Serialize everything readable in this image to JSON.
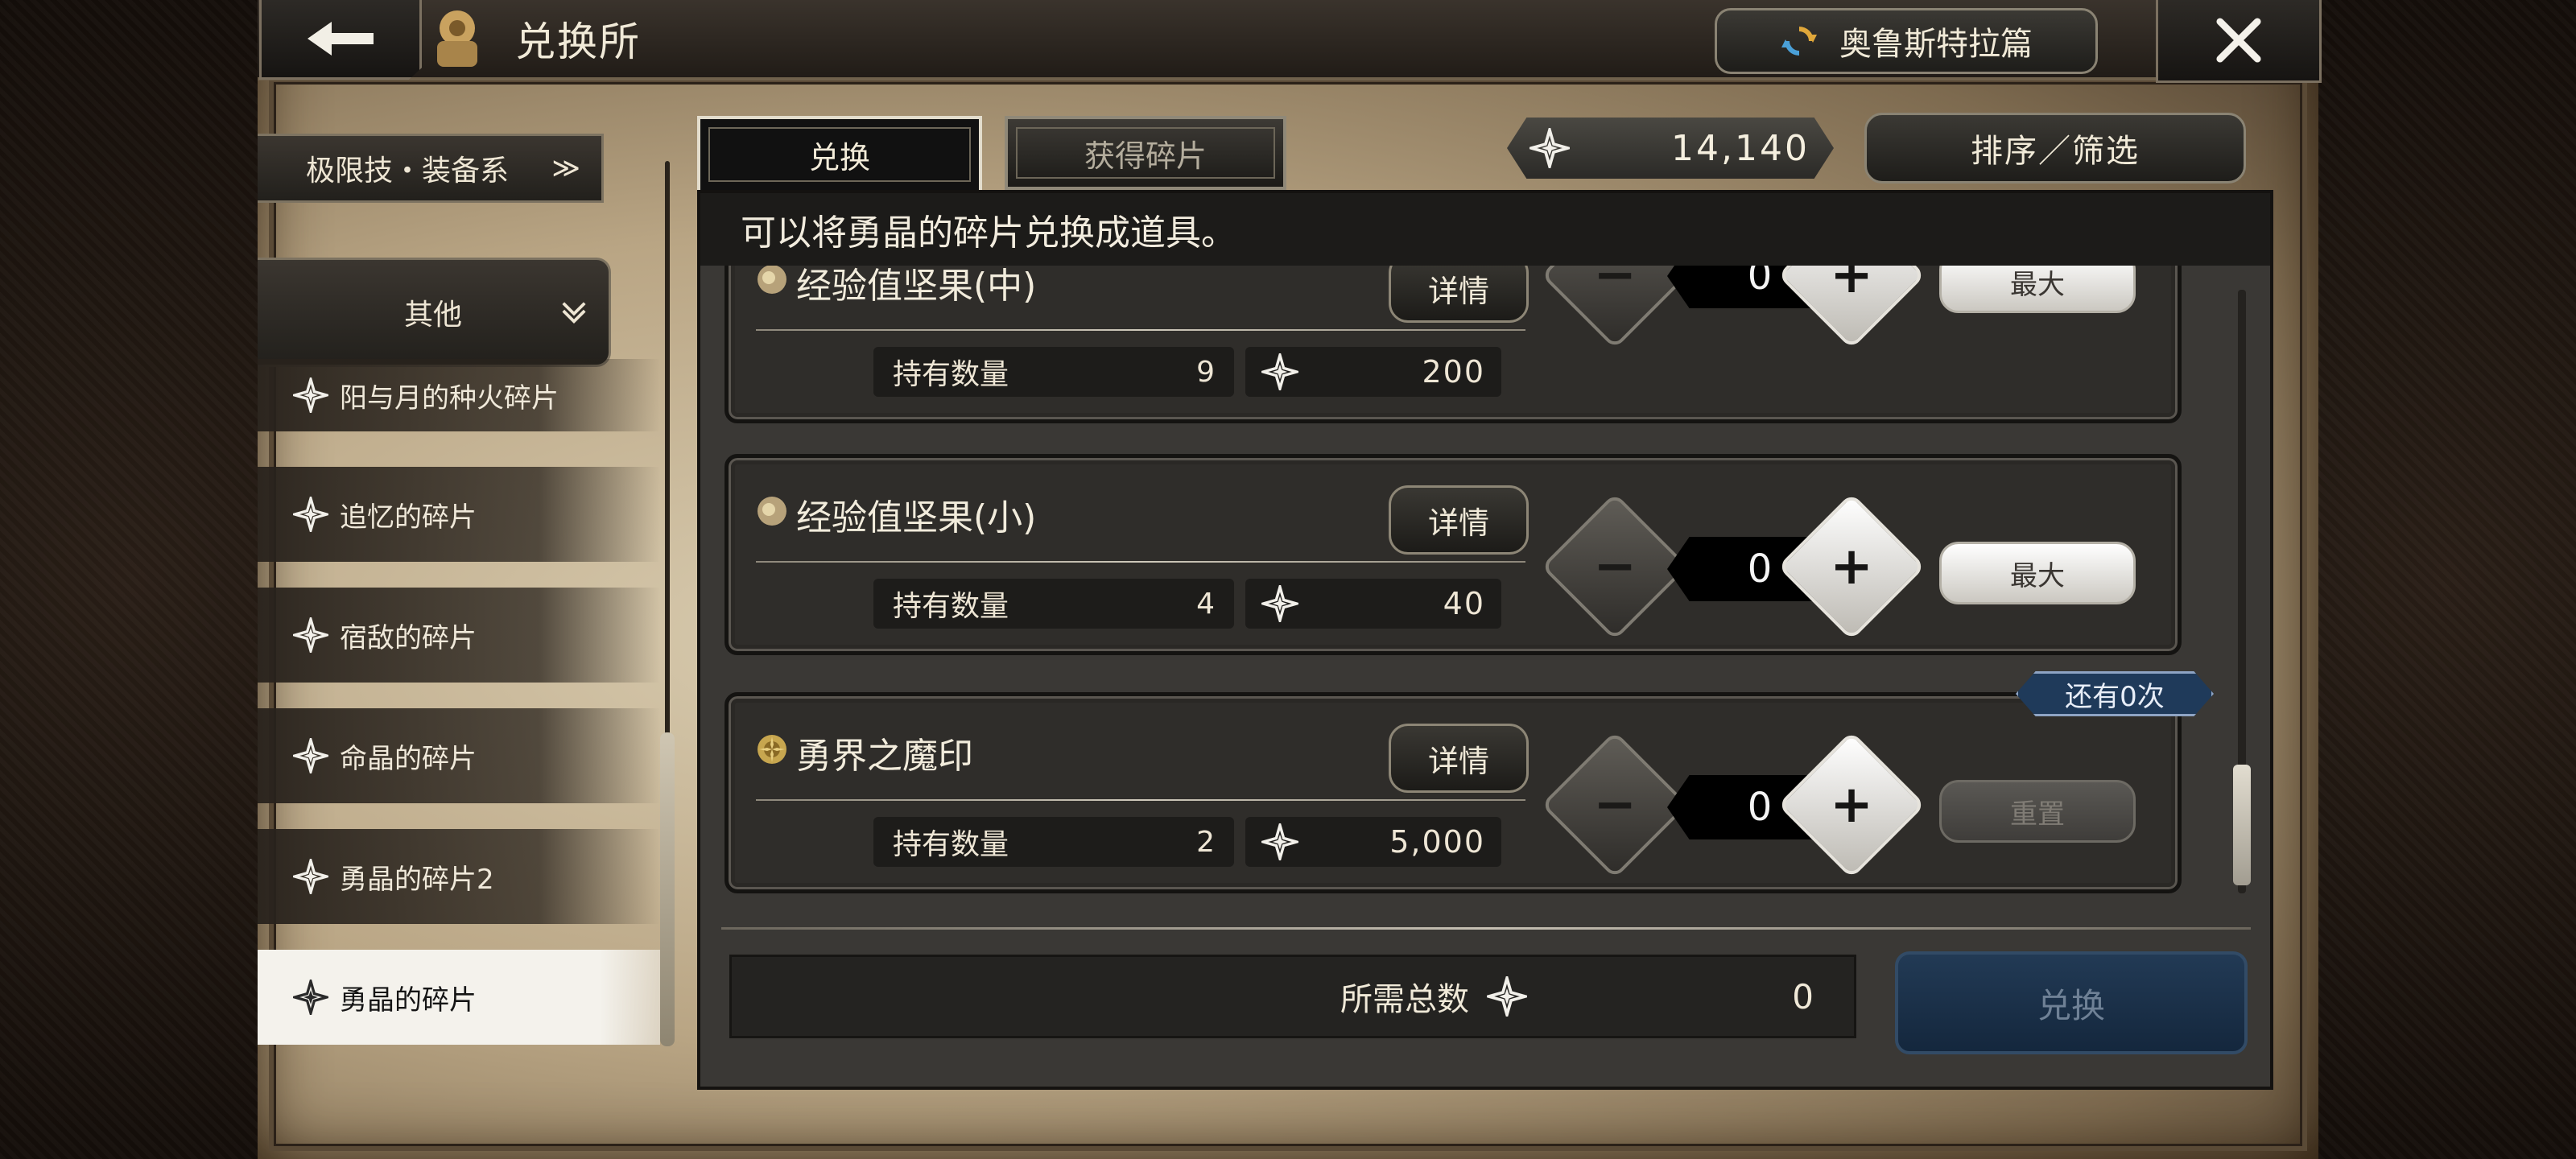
{
  "header": {
    "title": "兑换所",
    "back_icon": "back-arrow-icon",
    "chapter_label": "奥鲁斯特拉篇",
    "close_icon": "close-icon"
  },
  "sidebar": {
    "top_category": "极限技・装备系",
    "section_label": "其他",
    "items": [
      {
        "label": "阳与月的种火碎片",
        "active": false
      },
      {
        "label": "追忆的碎片",
        "active": false
      },
      {
        "label": "宿敌的碎片",
        "active": false
      },
      {
        "label": "命晶的碎片",
        "active": false
      },
      {
        "label": "勇晶的碎片2",
        "active": false
      },
      {
        "label": "勇晶的碎片",
        "active": true
      }
    ]
  },
  "tabs": [
    {
      "label": "兑换",
      "active": true
    },
    {
      "label": "获得碎片",
      "active": false
    }
  ],
  "currency": {
    "value": "14,140",
    "icon": "shard-icon"
  },
  "sort_label": "排序／筛选",
  "info_text": "可以将勇晶的碎片兑换成道具。",
  "items": [
    {
      "name": "经验值坚果(中)",
      "detail_label": "详情",
      "owned_label": "持有数量",
      "owned": "9",
      "cost": "200",
      "qty": "0",
      "action_label": "最大",
      "action_enabled": true
    },
    {
      "name": "经验值坚果(小)",
      "detail_label": "详情",
      "owned_label": "持有数量",
      "owned": "4",
      "cost": "40",
      "qty": "0",
      "action_label": "最大",
      "action_enabled": true
    },
    {
      "name": "勇界之魔印",
      "detail_label": "详情",
      "owned_label": "持有数量",
      "owned": "2",
      "cost": "5,000",
      "qty": "0",
      "action_label": "重置",
      "action_enabled": false,
      "remaining": "还有0次"
    }
  ],
  "footer": {
    "total_label": "所需总数",
    "total_value": "0",
    "exchange_label": "兑换"
  },
  "colors": {
    "accent_blue": "#1f3a5a",
    "panel": "#3a3835",
    "parchment": "#c9b896"
  }
}
